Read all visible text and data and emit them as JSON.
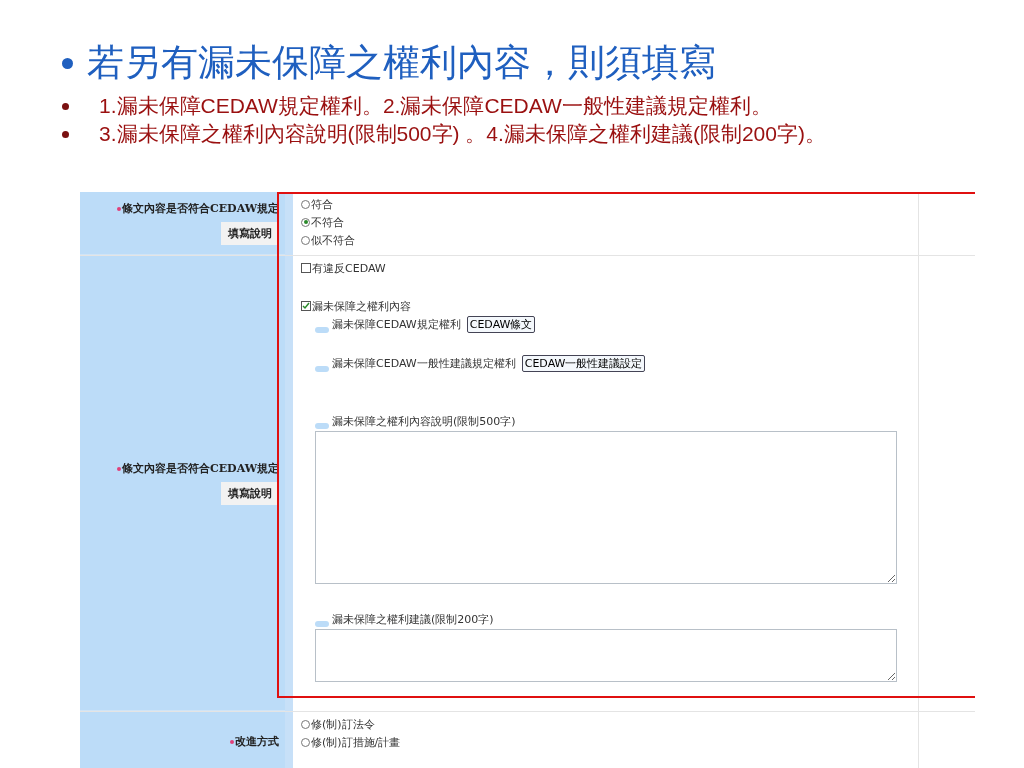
{
  "slide": {
    "title": "若另有漏未保障之權利內容，則須填寫",
    "bullets": [
      "1.漏未保障CEDAW規定權利。2.漏未保障CEDAW一般性建議規定權利。",
      "3.漏未保障之權利內容說明(限制500字) 。4.漏未保障之權利建議(限制200字)。"
    ]
  },
  "form": {
    "rows": [
      {
        "kind": "radios",
        "label": "條文內容是否符合CEDAW規定",
        "required": true,
        "help_button": "填寫說明",
        "options": [
          {
            "label": "符合",
            "selected": false
          },
          {
            "label": "不符合",
            "selected": true
          },
          {
            "label": "似不符合",
            "selected": false
          }
        ]
      },
      {
        "kind": "details",
        "label": "條文內容是否符合CEDAW規定",
        "required": true,
        "help_button": "填寫說明",
        "checkboxes": [
          {
            "label": "有違反CEDAW",
            "checked": false
          },
          {
            "label": "漏未保障之權利內容",
            "checked": true
          }
        ],
        "links": [
          {
            "label": "漏未保障CEDAW規定權利",
            "button": "CEDAW條文"
          },
          {
            "label": "漏未保障CEDAW一般性建議規定權利",
            "button": "CEDAW一般性建議設定"
          }
        ],
        "textareas": [
          {
            "label": "漏未保障之權利內容說明(限制500字)"
          },
          {
            "label": "漏未保障之權利建議(限制200字)"
          }
        ]
      },
      {
        "kind": "radios",
        "label": "改進方式",
        "required": true,
        "options": [
          {
            "label": "修(制)訂法令",
            "selected": false
          },
          {
            "label": "修(制)訂措施/計畫",
            "selected": false
          }
        ]
      }
    ]
  }
}
